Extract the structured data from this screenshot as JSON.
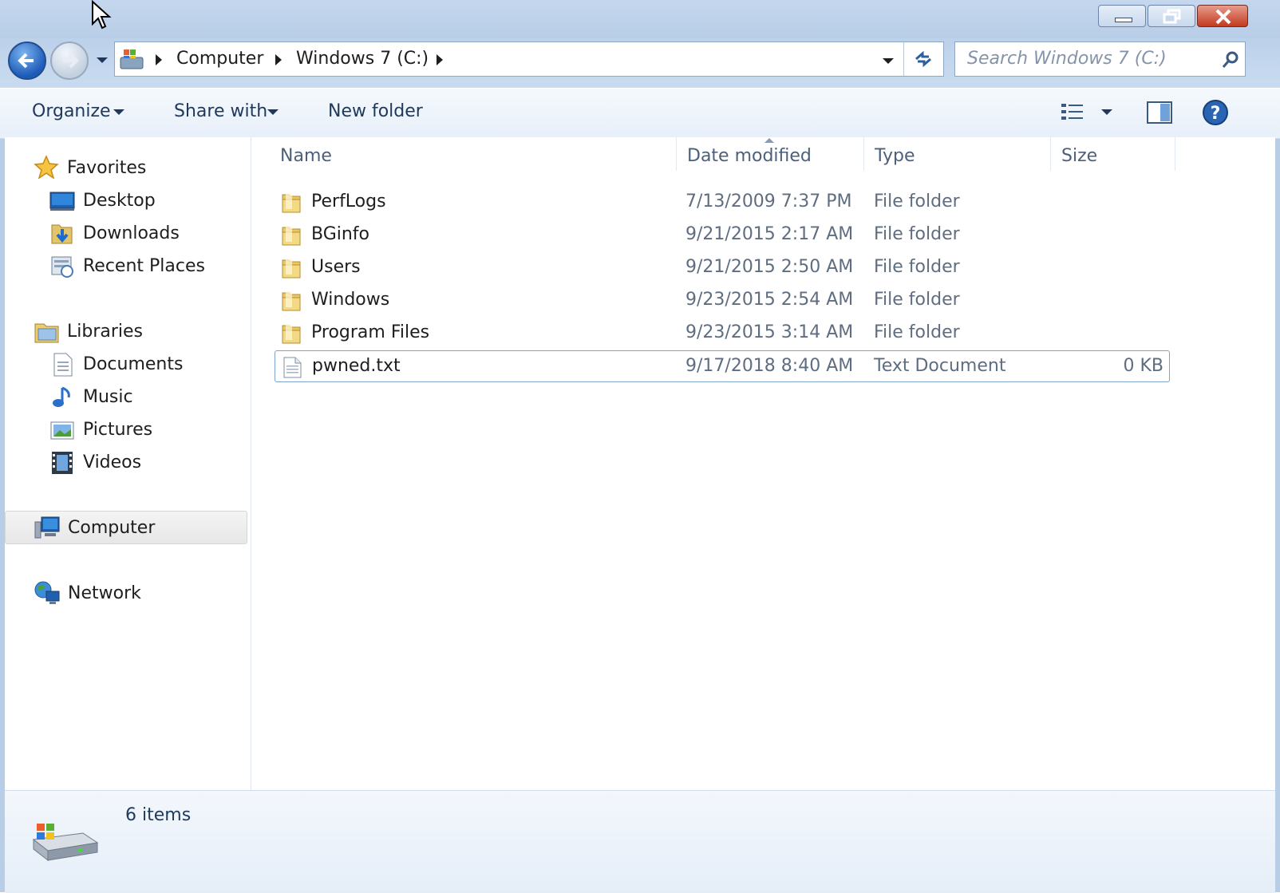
{
  "window": {
    "controls": {
      "minimize": "minimize",
      "restore": "restore",
      "close": "close"
    }
  },
  "address": {
    "crumbs": [
      "Computer",
      "Windows 7 (C:)"
    ],
    "search_placeholder": "Search Windows 7 (C:)"
  },
  "toolbar": {
    "organize": "Organize",
    "share_with": "Share with",
    "new_folder": "New folder"
  },
  "nav": {
    "favorites": {
      "label": "Favorites",
      "items": [
        "Desktop",
        "Downloads",
        "Recent Places"
      ]
    },
    "libraries": {
      "label": "Libraries",
      "items": [
        "Documents",
        "Music",
        "Pictures",
        "Videos"
      ]
    },
    "computer": "Computer",
    "network": "Network"
  },
  "columns": {
    "name": "Name",
    "date": "Date modified",
    "type": "Type",
    "size": "Size"
  },
  "files": [
    {
      "name": "PerfLogs",
      "date": "7/13/2009 7:37 PM",
      "type": "File folder",
      "size": "",
      "icon": "folder-icon"
    },
    {
      "name": "BGinfo",
      "date": "9/21/2015 2:17 AM",
      "type": "File folder",
      "size": "",
      "icon": "folder-icon"
    },
    {
      "name": "Users",
      "date": "9/21/2015 2:50 AM",
      "type": "File folder",
      "size": "",
      "icon": "folder-icon"
    },
    {
      "name": "Windows",
      "date": "9/23/2015 2:54 AM",
      "type": "File folder",
      "size": "",
      "icon": "folder-icon"
    },
    {
      "name": "Program Files",
      "date": "9/23/2015 3:14 AM",
      "type": "File folder",
      "size": "",
      "icon": "folder-icon"
    },
    {
      "name": "pwned.txt",
      "date": "9/17/2018 8:40 AM",
      "type": "Text Document",
      "size": "0 KB",
      "icon": "text-file-icon"
    }
  ],
  "status": {
    "count": "6 items"
  },
  "colors": {
    "selection_border": "#7da2ce",
    "frame": "#b8cde6"
  }
}
